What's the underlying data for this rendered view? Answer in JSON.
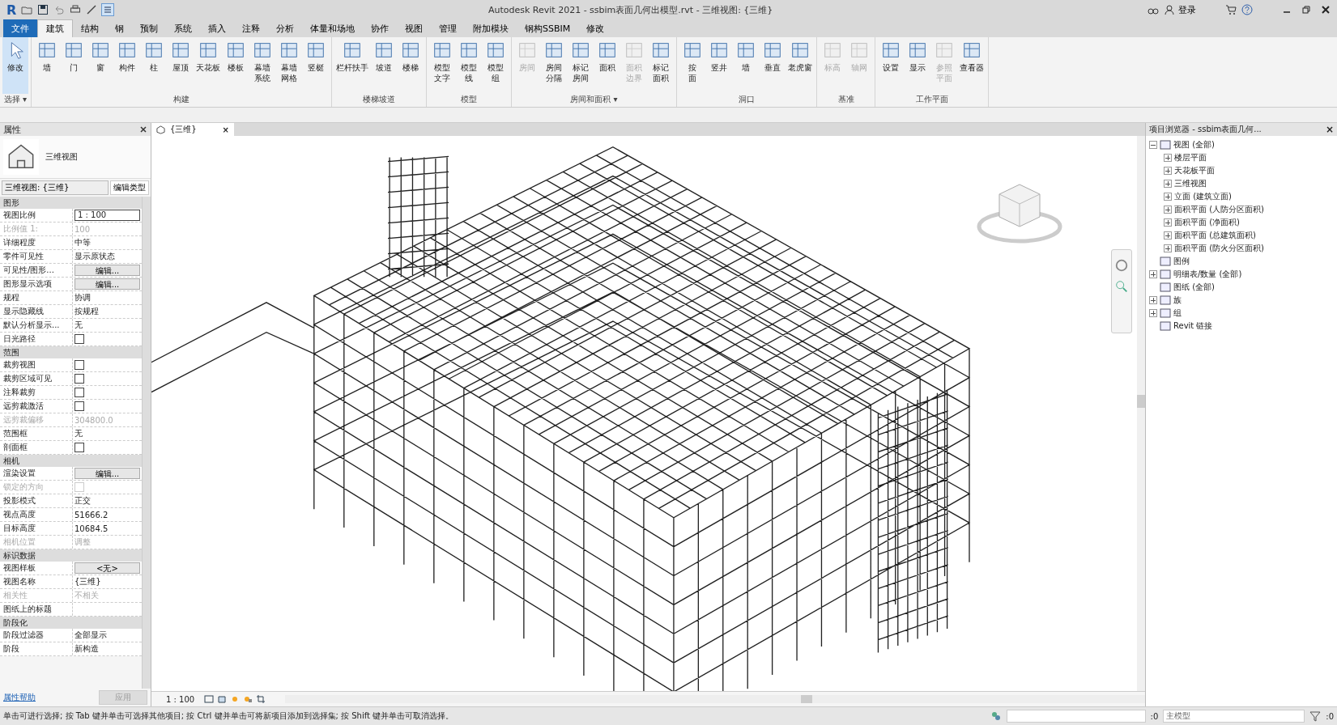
{
  "window": {
    "logo": "R",
    "title": "Autodesk Revit 2021 - ssbim表面几何出模型.rvt - 三维视图: {三维}",
    "sign_in": "登录"
  },
  "ribbon_tabs": [
    {
      "label": "文件",
      "kind": "file",
      "selected": false
    },
    {
      "label": "建筑",
      "kind": "tab",
      "selected": true
    },
    {
      "label": "结构",
      "kind": "tab",
      "selected": false
    },
    {
      "label": "钢",
      "kind": "tab",
      "selected": false
    },
    {
      "label": "预制",
      "kind": "tab",
      "selected": false
    },
    {
      "label": "系统",
      "kind": "tab",
      "selected": false
    },
    {
      "label": "插入",
      "kind": "tab",
      "selected": false
    },
    {
      "label": "注释",
      "kind": "tab",
      "selected": false
    },
    {
      "label": "分析",
      "kind": "tab",
      "selected": false
    },
    {
      "label": "体量和场地",
      "kind": "tab",
      "selected": false
    },
    {
      "label": "协作",
      "kind": "tab",
      "selected": false
    },
    {
      "label": "视图",
      "kind": "tab",
      "selected": false
    },
    {
      "label": "管理",
      "kind": "tab",
      "selected": false
    },
    {
      "label": "附加模块",
      "kind": "tab",
      "selected": false
    },
    {
      "label": "钢构SSBIM",
      "kind": "tab",
      "selected": false
    },
    {
      "label": "修改",
      "kind": "tab",
      "selected": false
    }
  ],
  "ribbon_groups": [
    {
      "label": "选择 ▾",
      "buttons": [
        {
          "label": "修改",
          "disabled": false,
          "selected": true
        }
      ]
    },
    {
      "label": "构建",
      "buttons": [
        {
          "label": "墙",
          "disabled": false,
          "selected": false
        },
        {
          "label": "门",
          "disabled": false,
          "selected": false
        },
        {
          "label": "窗",
          "disabled": false,
          "selected": false
        },
        {
          "label": "构件",
          "disabled": false,
          "selected": false
        },
        {
          "label": "柱",
          "disabled": false,
          "selected": false
        },
        {
          "label": "屋顶",
          "disabled": false,
          "selected": false
        },
        {
          "label": "天花板",
          "disabled": false,
          "selected": false
        },
        {
          "label": "楼板",
          "disabled": false,
          "selected": false
        },
        {
          "label": "幕墙系统",
          "wrap": true,
          "disabled": false,
          "selected": false
        },
        {
          "label": "幕墙网格",
          "wrap": true,
          "disabled": false,
          "selected": false
        },
        {
          "label": "竖梃",
          "disabled": false,
          "selected": false
        }
      ]
    },
    {
      "label": "楼梯坡道",
      "buttons": [
        {
          "label": "栏杆扶手",
          "disabled": false,
          "selected": false
        },
        {
          "label": "坡道",
          "disabled": false,
          "selected": false
        },
        {
          "label": "楼梯",
          "disabled": false,
          "selected": false
        }
      ]
    },
    {
      "label": "模型",
      "buttons": [
        {
          "label": "模型文字",
          "wrap": true,
          "disabled": false,
          "selected": false
        },
        {
          "label": "模型线",
          "wrap": true,
          "disabled": false,
          "selected": false
        },
        {
          "label": "模型组",
          "wrap": true,
          "disabled": false,
          "selected": false
        }
      ]
    },
    {
      "label": "房间和面积 ▾",
      "buttons": [
        {
          "label": "房间",
          "disabled": true,
          "selected": false
        },
        {
          "label": "房间分隔",
          "wrap": true,
          "disabled": false,
          "selected": false
        },
        {
          "label": "标记房间",
          "wrap": true,
          "disabled": false,
          "selected": false
        },
        {
          "label": "面积",
          "disabled": false,
          "selected": false
        },
        {
          "label": "面积边界",
          "wrap": true,
          "disabled": true,
          "selected": false
        },
        {
          "label": "标记面积",
          "wrap": true,
          "disabled": false,
          "selected": false
        }
      ]
    },
    {
      "label": "洞口",
      "buttons": [
        {
          "label": "按面",
          "wrap": true,
          "disabled": false,
          "selected": false
        },
        {
          "label": "竖井",
          "disabled": false,
          "selected": false
        },
        {
          "label": "墙",
          "disabled": false,
          "selected": false
        },
        {
          "label": "垂直",
          "disabled": false,
          "selected": false
        },
        {
          "label": "老虎窗",
          "disabled": false,
          "selected": false
        }
      ]
    },
    {
      "label": "基准",
      "buttons": [
        {
          "label": "标高",
          "disabled": true,
          "selected": false
        },
        {
          "label": "轴网",
          "disabled": true,
          "selected": false
        }
      ]
    },
    {
      "label": "工作平面",
      "buttons": [
        {
          "label": "设置",
          "disabled": false,
          "selected": false
        },
        {
          "label": "显示",
          "disabled": false,
          "selected": false
        },
        {
          "label": "参照平面",
          "wrap": true,
          "disabled": true,
          "selected": false
        },
        {
          "label": "查看器",
          "disabled": false,
          "selected": false
        }
      ]
    }
  ],
  "properties": {
    "title": "属性",
    "type_name": "三维视图",
    "instance_selector": "三维视图: {三维}",
    "edit_type": "编辑类型",
    "sections": [
      {
        "label": "图形",
        "rows": [
          {
            "label": "视图比例",
            "kind": "field",
            "value": "1 : 100",
            "disabled": false
          },
          {
            "label": "比例值 1:",
            "kind": "text",
            "value": "100",
            "disabled": true
          },
          {
            "label": "详细程度",
            "kind": "text",
            "value": "中等",
            "disabled": false
          },
          {
            "label": "零件可见性",
            "kind": "text",
            "value": "显示原状态",
            "disabled": false
          },
          {
            "label": "可见性/图形...",
            "kind": "button",
            "value": "编辑...",
            "disabled": false
          },
          {
            "label": "图形显示选项",
            "kind": "button",
            "value": "编辑...",
            "disabled": false
          },
          {
            "label": "规程",
            "kind": "text",
            "value": "协调",
            "disabled": false
          },
          {
            "label": "显示隐藏线",
            "kind": "text",
            "value": "按规程",
            "disabled": false
          },
          {
            "label": "默认分析显示...",
            "kind": "text",
            "value": "无",
            "disabled": false
          },
          {
            "label": "日光路径",
            "kind": "checkbox",
            "checked": false,
            "disabled": false
          }
        ]
      },
      {
        "label": "范围",
        "rows": [
          {
            "label": "裁剪视图",
            "kind": "checkbox",
            "checked": false,
            "disabled": false
          },
          {
            "label": "裁剪区域可见",
            "kind": "checkbox",
            "checked": false,
            "disabled": false
          },
          {
            "label": "注释裁剪",
            "kind": "checkbox",
            "checked": false,
            "disabled": false
          },
          {
            "label": "远剪裁激活",
            "kind": "checkbox",
            "checked": false,
            "disabled": false
          },
          {
            "label": "远剪裁偏移",
            "kind": "text",
            "value": "304800.0",
            "disabled": true
          },
          {
            "label": "范围框",
            "kind": "text",
            "value": "无",
            "disabled": false
          },
          {
            "label": "剖面框",
            "kind": "checkbox",
            "checked": false,
            "disabled": false
          }
        ]
      },
      {
        "label": "相机",
        "rows": [
          {
            "label": "渲染设置",
            "kind": "button",
            "value": "编辑...",
            "disabled": false
          },
          {
            "label": "锁定的方向",
            "kind": "checkbox",
            "checked": false,
            "disabled": true
          },
          {
            "label": "投影模式",
            "kind": "text",
            "value": "正交",
            "disabled": false
          },
          {
            "label": "视点高度",
            "kind": "text",
            "value": "51666.2",
            "disabled": false
          },
          {
            "label": "目标高度",
            "kind": "text",
            "value": "10684.5",
            "disabled": false
          },
          {
            "label": "相机位置",
            "kind": "text",
            "value": "调整",
            "disabled": true
          }
        ]
      },
      {
        "label": "标识数据",
        "rows": [
          {
            "label": "视图样板",
            "kind": "button",
            "value": "<无>",
            "disabled": false
          },
          {
            "label": "视图名称",
            "kind": "text",
            "value": "{三维}",
            "disabled": false
          },
          {
            "label": "相关性",
            "kind": "text",
            "value": "不相关",
            "disabled": true
          },
          {
            "label": "图纸上的标题",
            "kind": "text",
            "disabled": false
          }
        ]
      },
      {
        "label": "阶段化",
        "rows": [
          {
            "label": "阶段过滤器",
            "kind": "text",
            "value": "全部显示",
            "disabled": false
          },
          {
            "label": "阶段",
            "kind": "text",
            "value": "新构造",
            "disabled": false
          }
        ]
      }
    ],
    "help_link": "属性帮助",
    "apply_button": {
      "label": "应用",
      "disabled": true
    }
  },
  "view_tab": {
    "label": "{三维}",
    "close": "×"
  },
  "project_browser": {
    "title": "项目浏览器 - ssbim表面几何...",
    "close": "×",
    "tree": [
      {
        "label": "视图 (全部)",
        "expanded": true,
        "children": [
          {
            "label": "楼层平面",
            "expanded": false
          },
          {
            "label": "天花板平面",
            "expanded": false
          },
          {
            "label": "三维视图",
            "expanded": false
          },
          {
            "label": "立面 (建筑立面)",
            "expanded": false
          },
          {
            "label": "面积平面 (人防分区面积)",
            "expanded": false
          },
          {
            "label": "面积平面 (净面积)",
            "expanded": false
          },
          {
            "label": "面积平面 (总建筑面积)",
            "expanded": false
          },
          {
            "label": "面积平面 (防火分区面积)",
            "expanded": false
          }
        ]
      },
      {
        "label": "图例"
      },
      {
        "label": "明细表/数量 (全部)",
        "expanded": false
      },
      {
        "label": "图纸 (全部)"
      },
      {
        "label": "族",
        "expanded": false
      },
      {
        "label": "组",
        "expanded": false
      },
      {
        "label": "Revit 链接"
      }
    ]
  },
  "view_control_bar": {
    "scale": "1 : 100"
  },
  "status_bar": {
    "message": "单击可进行选择; 按 Tab 键并单击可选择其他项目; 按 Ctrl 键并单击可将新项目添加到选择集; 按 Shift 键并单击可取消选择。",
    "workset_count": ":0",
    "model": "主模型",
    "filter_count": ":0"
  }
}
